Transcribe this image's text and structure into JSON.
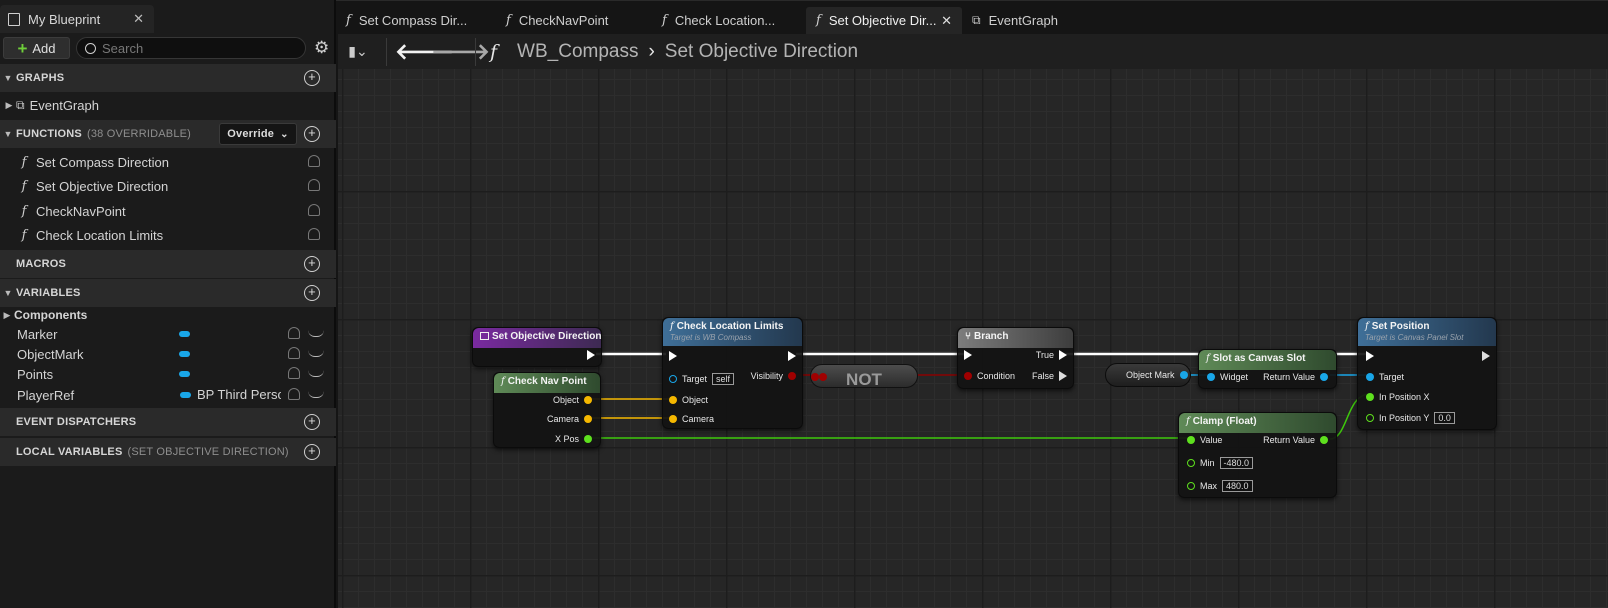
{
  "left_panel": {
    "tab_title": "My Blueprint",
    "add_label": "Add",
    "search_placeholder": "Search",
    "sections": {
      "graphs": "GRAPHS",
      "functions": "FUNCTIONS",
      "functions_sub": "(38 OVERRIDABLE)",
      "override_label": "Override",
      "macros": "MACROS",
      "variables": "VARIABLES",
      "event_dispatchers": "EVENT DISPATCHERS",
      "local_variables": "LOCAL VARIABLES",
      "local_variables_sub": "(SET OBJECTIVE DIRECTION)"
    },
    "graph_items": [
      "EventGraph"
    ],
    "function_items": [
      "Set Compass Direction",
      "Set Objective Direction",
      "CheckNavPoint",
      "Check Location Limits"
    ],
    "variables": {
      "components_label": "Components",
      "items": [
        {
          "name": "Marker",
          "type": ""
        },
        {
          "name": "ObjectMark",
          "type": ""
        },
        {
          "name": "Points",
          "type": ""
        },
        {
          "name": "PlayerRef",
          "type": "BP Third Perso"
        }
      ]
    }
  },
  "doc_tabs": [
    {
      "label": "Set Compass Dir...",
      "active": false
    },
    {
      "label": "CheckNavPoint",
      "active": false
    },
    {
      "label": "Check Location...",
      "active": false
    },
    {
      "label": "Set Objective Dir...",
      "active": true
    },
    {
      "label": "EventGraph",
      "active": false
    }
  ],
  "breadcrumb": {
    "root": "WB_Compass",
    "current": "Set Objective Direction"
  },
  "graph": {
    "entry": {
      "title": "Set Objective Direction"
    },
    "check_nav": {
      "title": "Check Nav Point",
      "pins": [
        "Object",
        "Camera",
        "X Pos"
      ]
    },
    "check_loc": {
      "title": "Check Location Limits",
      "subtitle": "Target is WB Compass",
      "target_label": "Target",
      "target_value": "self",
      "pins": [
        "Object",
        "Camera"
      ],
      "out_pin": "Visibility"
    },
    "not_node": {
      "label": "NOT"
    },
    "branch": {
      "title": "Branch",
      "true_label": "True",
      "false_label": "False",
      "condition_label": "Condition"
    },
    "object_mark": {
      "label": "Object Mark"
    },
    "slot_canvas": {
      "title": "Slot as Canvas Slot",
      "in_label": "Widget",
      "out_label": "Return Value"
    },
    "clamp": {
      "title": "Clamp (Float)",
      "value_label": "Value",
      "return_label": "Return Value",
      "min_label": "Min",
      "min_value": "-480.0",
      "max_label": "Max",
      "max_value": "480.0"
    },
    "set_position": {
      "title": "Set Position",
      "subtitle": "Target is Canvas Panel Slot",
      "target_label": "Target",
      "x_label": "In Position X",
      "y_label": "In Position Y",
      "y_value": "0.0"
    }
  },
  "colors": {
    "exec": "#ffffff",
    "object_pin": "#f5b800",
    "float_pin": "#5ee01e",
    "bool_pin": "#a00000",
    "object_ref": "#19a6e8"
  }
}
